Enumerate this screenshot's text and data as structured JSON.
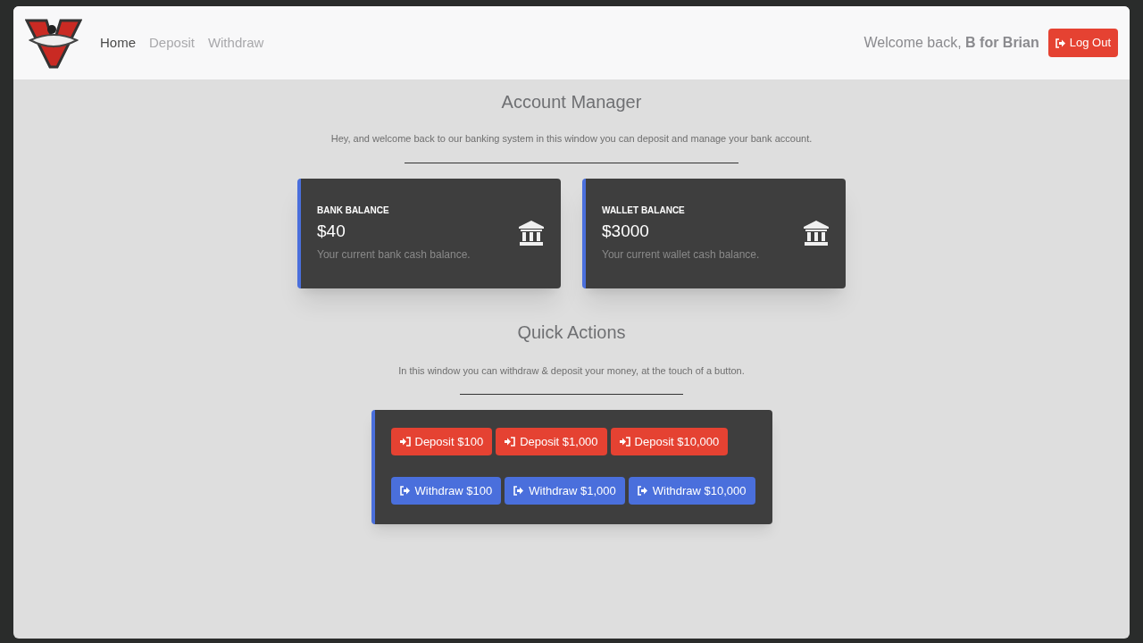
{
  "navbar": {
    "nav_items": [
      {
        "label": "Home",
        "selected": true
      },
      {
        "label": "Deposit",
        "selected": false
      },
      {
        "label": "Withdraw",
        "selected": false
      }
    ],
    "welcome": "Welcome back, **B for Brian**",
    "logout_button": "Log Out"
  },
  "account_manager": {
    "title": "Account Manager",
    "description": "Hey, and welcome back to our banking system in this window you can deposit and manage your bank account.",
    "cards": [
      {
        "label": "BANK BALANCE",
        "amount": "$40",
        "caption": "Your current bank cash balance."
      },
      {
        "label": "WALLET BALANCE",
        "amount": "$3000",
        "caption": "Your current wallet cash balance."
      }
    ]
  },
  "quick_actions": {
    "title": "Quick Actions",
    "description": "In this window you can withdraw & deposit your money, at the touch of a button.",
    "buttons": [
      {
        "kind": "deposit",
        "label": "Deposit $100"
      },
      {
        "kind": "deposit",
        "label": "Deposit $1,000"
      },
      {
        "kind": "deposit",
        "label": "Deposit $10,000"
      },
      {
        "kind": "withdraw",
        "label": "Withdraw $100"
      },
      {
        "kind": "withdraw",
        "label": "Withdraw $1,000"
      },
      {
        "kind": "withdraw",
        "label": "Withdraw $10,000"
      }
    ]
  }
}
